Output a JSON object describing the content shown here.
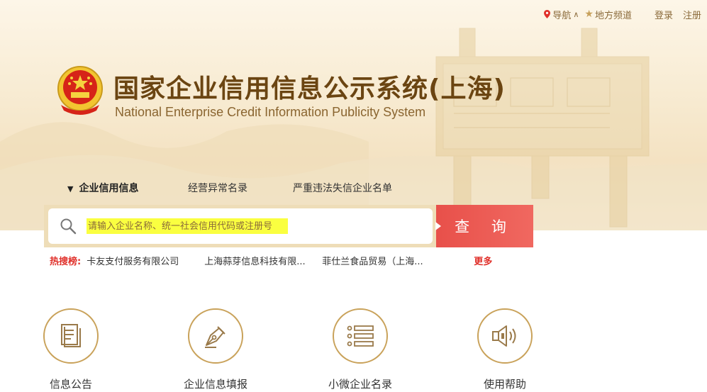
{
  "topbar": {
    "nav_label": "导航",
    "local_label": "地方频道",
    "login_label": "登录",
    "register_label": "注册"
  },
  "header": {
    "title_cn": "国家企业信用信息公示系统(上海)",
    "title_en": "National Enterprise Credit Information Publicity System"
  },
  "tabs": [
    {
      "label": "企业信用信息",
      "active": true
    },
    {
      "label": "经营异常名录",
      "active": false
    },
    {
      "label": "严重违法失信企业名单",
      "active": false
    }
  ],
  "search": {
    "placeholder": "请输入企业名称、统一社会信用代码或注册号",
    "button_label": "查 询"
  },
  "hot_search": {
    "label": "热搜榜:",
    "items": [
      "卡友支付服务有限公司",
      "上海蒜芽信息科技有限...",
      "菲仕兰食品贸易（上海..."
    ],
    "more_label": "更多"
  },
  "features": [
    {
      "label": "信息公告",
      "icon": "document-icon"
    },
    {
      "label": "企业信息填报",
      "icon": "pen-nib-icon"
    },
    {
      "label": "小微企业名录",
      "icon": "list-icon"
    },
    {
      "label": "使用帮助",
      "icon": "speaker-icon"
    }
  ],
  "colors": {
    "brand_brown": "#6b4512",
    "accent_red": "#e8504a",
    "gold": "#c9a25a"
  }
}
